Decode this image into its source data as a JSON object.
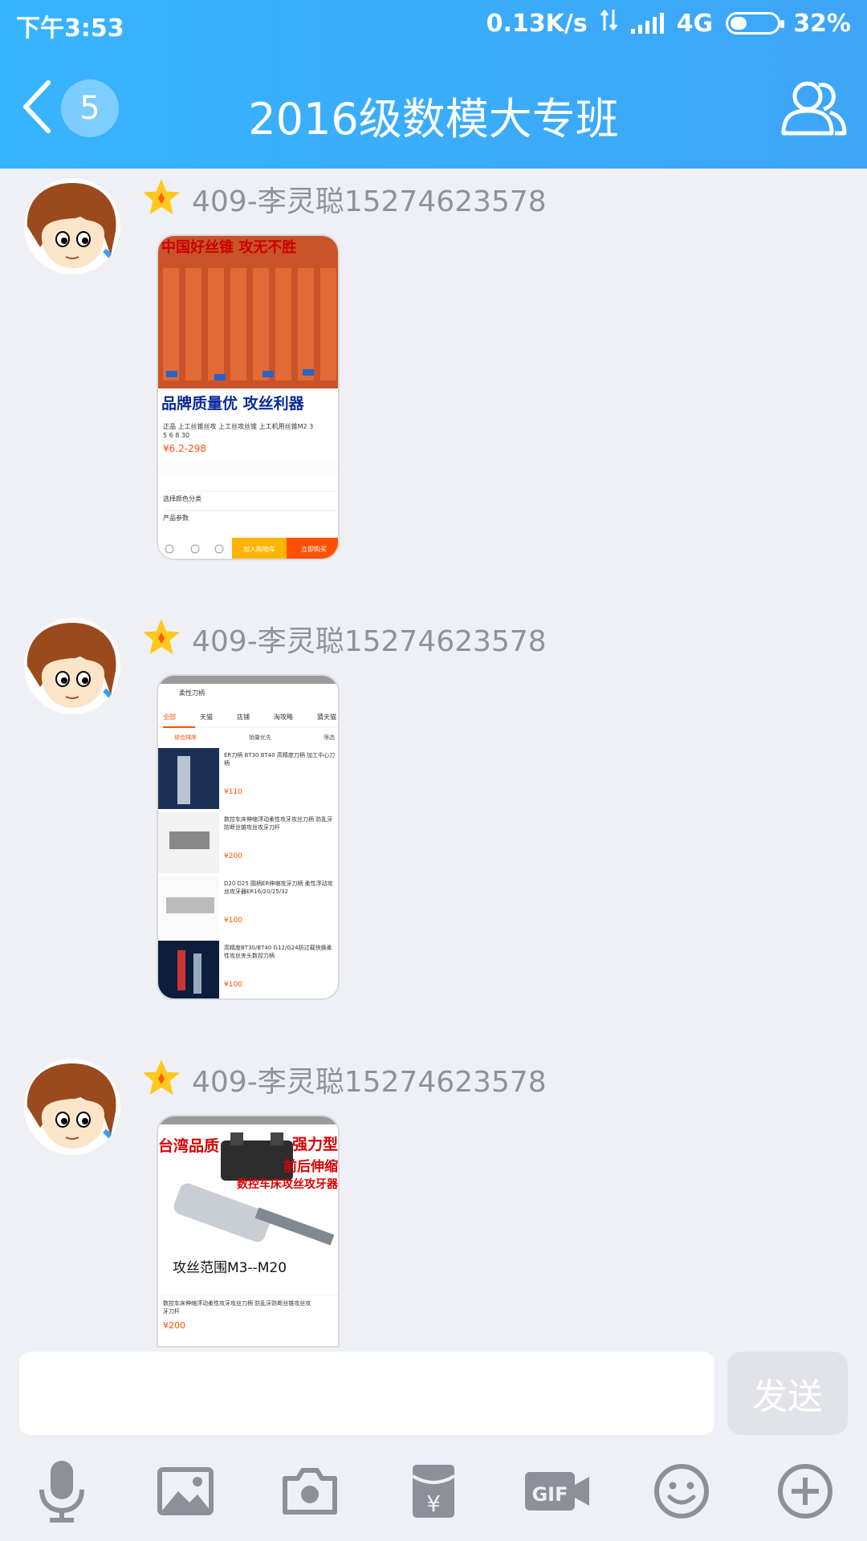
{
  "status_bar": {
    "time": "下午3:53",
    "network_speed": "0.13K/s",
    "network_type": "4G",
    "battery": "32%"
  },
  "header": {
    "back_icon": "chevron-left-icon",
    "unread_count": "5",
    "title": "2016级数模大专班",
    "profile_icon": "group-members-icon",
    "background_colors": [
      "#37b4ff",
      "#3ea5f7"
    ]
  },
  "messages": [
    {
      "sender": "409-李灵聪15274623578",
      "badge_icon": "star-badge-icon",
      "image": {
        "banner_text": "中国好丝锥 攻无不胜",
        "slogan": "品牌质量优 攻丝利器",
        "product_title": "正品 上工丝锥丝攻 上工丝攻丝锥 上工机用丝锥M2 3 5 6 8 30",
        "price": "¥6.2-298",
        "row1": "选择颜色分类",
        "row2": "产品参数",
        "cart_button": "加入购物车",
        "buy_button": "立即购买"
      }
    },
    {
      "sender": "409-李灵聪15274623578",
      "badge_icon": "star-badge-icon",
      "image": {
        "search_text": "柔性刀柄",
        "tabs": [
          "全部",
          "天猫",
          "店铺",
          "淘攻略",
          "猜天猫"
        ],
        "sort": [
          "综合排序",
          "销量优先",
          "筛选"
        ],
        "items": [
          {
            "title": "ER刀柄 BT30 BT40 高精度刀柄 加工中心刀柄",
            "price": "¥110"
          },
          {
            "title": "数控车床伸缩浮动柔性攻牙攻丝刀柄 防乱牙防断丝锥攻丝攻牙刀杆",
            "price": "¥200"
          },
          {
            "title": "D20 D25 圆柄ER伸缩攻牙刀柄 柔性浮动攻丝攻牙器ER16/20/25/32",
            "price": "¥100"
          },
          {
            "title": "高精度BT30/BT40 G12/G24防过载快换柔性攻丝夹头数控刀柄",
            "price": "¥100"
          }
        ]
      }
    },
    {
      "sender": "409-李灵聪15274623578",
      "badge_icon": "star-badge-icon",
      "image": {
        "banner_left": "台湾品质",
        "banner_right": "强力型",
        "subtitle": "前后伸缩",
        "red_line": "数控车床攻丝攻牙器",
        "range_text": "攻丝范围M3--M20",
        "product_title": "数控车床伸缩浮动柔性攻牙攻丝刀柄 防乱牙防断丝锥攻丝攻牙刀杆",
        "price": "¥200"
      }
    }
  ],
  "composer": {
    "send_label": "发送",
    "placeholder": ""
  },
  "toolbar": [
    "microphone-icon",
    "image-icon",
    "camera-icon",
    "red-packet-icon",
    "gif-icon",
    "emoji-icon",
    "plus-icon"
  ]
}
